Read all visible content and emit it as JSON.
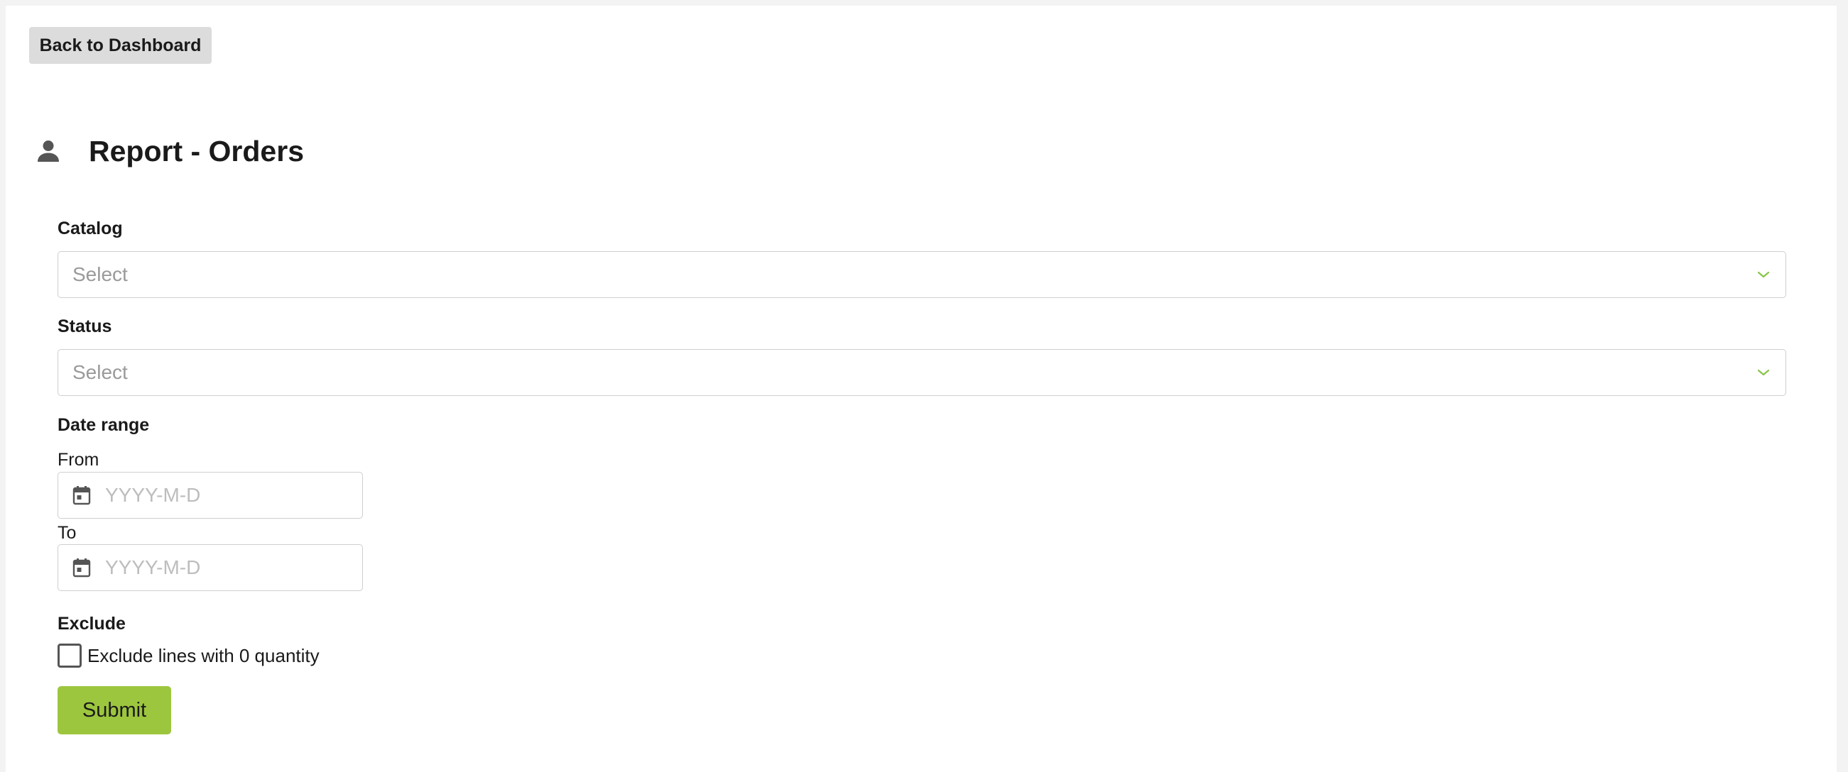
{
  "header": {
    "back_label": "Back to Dashboard",
    "title": "Report - Orders",
    "title_icon": "person-icon"
  },
  "form": {
    "catalog": {
      "label": "Catalog",
      "placeholder": "Select"
    },
    "status": {
      "label": "Status",
      "placeholder": "Select"
    },
    "date_range": {
      "label": "Date range",
      "from_label": "From",
      "from_placeholder": "YYYY-M-D",
      "to_label": "To",
      "to_placeholder": "YYYY-M-D"
    },
    "exclude": {
      "label": "Exclude",
      "checkbox_label": "Exclude lines with 0 quantity",
      "checked": false
    },
    "submit_label": "Submit"
  },
  "colors": {
    "accent": "#9dc63f",
    "chevron": "#8bc34a",
    "icon": "#555555",
    "back_button_bg": "#dcdcdc"
  }
}
